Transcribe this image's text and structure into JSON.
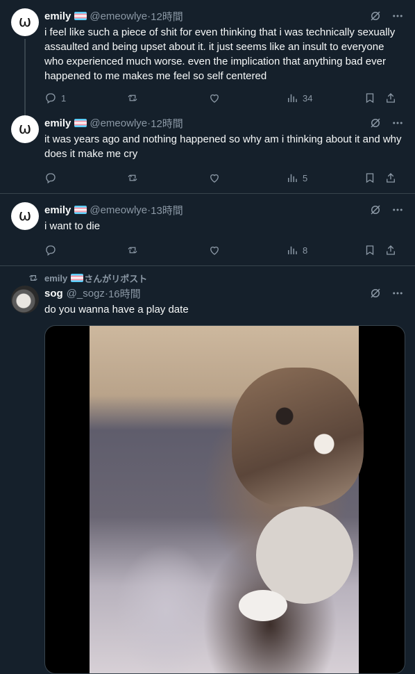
{
  "tweets": [
    {
      "name": "emily",
      "handle": "@emeowlye",
      "time": "12時間",
      "avatar_icon": "ω",
      "text": "i feel like such a piece of shit for even thinking that i was technically sexually assaulted and being upset about it. it just seems like an insult to everyone who experienced much worse. even the implication that anything bad ever happened to me makes me feel so self centered",
      "replies": "1",
      "reposts": "",
      "likes": "",
      "views": "34"
    },
    {
      "name": "emily",
      "handle": "@emeowlye",
      "time": "12時間",
      "avatar_icon": "ω",
      "text": "it was years ago and nothing happened so why am i thinking about it and why does it make me cry",
      "replies": "",
      "reposts": "",
      "likes": "",
      "views": "5"
    },
    {
      "name": "emily",
      "handle": "@emeowlye",
      "time": "13時間",
      "avatar_icon": "ω",
      "text": "i want to die",
      "replies": "",
      "reposts": "",
      "likes": "",
      "views": "8"
    },
    {
      "repost_label": "emily 🏳️‍⚧️さんがリポスト",
      "repost_user": "emily",
      "repost_suffix": "さんがリポスト",
      "name": "sog",
      "handle": "@_sogz",
      "time": "16時間",
      "text": "do you wanna have a play date",
      "media": "cat video"
    }
  ],
  "separator": " · ",
  "colors": {
    "background": "#15202b",
    "border": "#38444d",
    "muted": "#8b98a5",
    "text": "#f7f9f9"
  }
}
